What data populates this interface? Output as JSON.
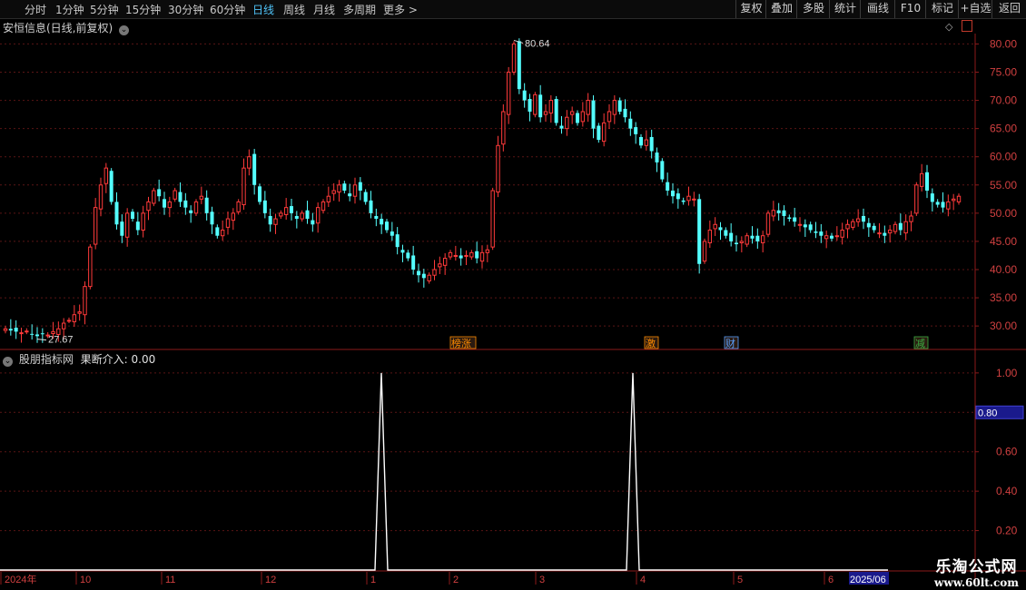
{
  "toolbar": {
    "periods": [
      "分时",
      "1分钟",
      "5分钟",
      "15分钟",
      "30分钟",
      "60分钟",
      "日线",
      "周线",
      "月线",
      "多周期",
      "更多 >"
    ],
    "active_period": "日线",
    "buttons": [
      "复权",
      "叠加",
      "多股",
      "统计",
      "画线",
      "F10",
      "标记",
      "+自选",
      "返回"
    ]
  },
  "main_panel": {
    "title": "安恒信息(日线,前复权)",
    "y_ticks": [
      "80.00",
      "75.00",
      "70.00",
      "65.00",
      "60.00",
      "55.00",
      "50.00",
      "45.00",
      "40.00",
      "35.00",
      "30.00"
    ],
    "high_label": "80.64",
    "low_label": "27.67",
    "event_tags": [
      {
        "label": "榜涨",
        "color": "#ff8c00"
      },
      {
        "label": "激",
        "color": "#ff8c00"
      },
      {
        "label": "财",
        "color": "#5aa0ff"
      },
      {
        "label": "减",
        "color": "#3cb043"
      }
    ]
  },
  "indicator_panel": {
    "title": "股朋指标网",
    "value_label": "果断介入: 0.00",
    "y_ticks": [
      "1.00",
      "0.80",
      "0.60",
      "0.40",
      "0.20"
    ],
    "cursor_value": "0.80"
  },
  "date_axis": {
    "labels": [
      "2024年",
      "10",
      "11",
      "12",
      "1",
      "2",
      "3",
      "4",
      "5",
      "6",
      "2025/06"
    ]
  },
  "watermark": {
    "line1": "乐淘公式网",
    "line2": "www.60lt.com"
  },
  "chart_data": {
    "type": "candlestick",
    "y_range": [
      26,
      82
    ],
    "indicator_y_range": [
      0,
      1.05
    ],
    "high": 80.64,
    "low": 27.67,
    "indicator_spikes": [
      {
        "month_label": "1",
        "value": 1.0
      },
      {
        "month_label": "4",
        "value": 1.0
      }
    ],
    "closes_approx": [
      29.5,
      29.2,
      29,
      28.8,
      29.1,
      28.5,
      28.2,
      28.6,
      28.4,
      29,
      29.5,
      30.5,
      31,
      32,
      32.5,
      37,
      44,
      51,
      55,
      58,
      52,
      48,
      46,
      50,
      49,
      47,
      50,
      52,
      54,
      53,
      51,
      52,
      54,
      52,
      51,
      50,
      52,
      53,
      50,
      48,
      46,
      47,
      49,
      50,
      52,
      58,
      60,
      55,
      52,
      50,
      48,
      49,
      50,
      51,
      50,
      49,
      50,
      49,
      48,
      51,
      52,
      53,
      54,
      55,
      54,
      53,
      55,
      54,
      52,
      50,
      49,
      48,
      47,
      46,
      44,
      43,
      42,
      40,
      39,
      38.5,
      39,
      40,
      41,
      42,
      43,
      42.5,
      42,
      42.5,
      43,
      42,
      43,
      43.5,
      54,
      62,
      68,
      75,
      80,
      72,
      70,
      68,
      71,
      67,
      68,
      70,
      66,
      65,
      67,
      68,
      66,
      68,
      70,
      65,
      63,
      66,
      68,
      70,
      68,
      67,
      65,
      64,
      62,
      63,
      61,
      59,
      56,
      54,
      53,
      52.5,
      52,
      53,
      52.5,
      41,
      45,
      47,
      48,
      47,
      46,
      45,
      44.5,
      45,
      46,
      45.5,
      45,
      46,
      50,
      50.5,
      50,
      49.5,
      49,
      48.5,
      48,
      47.5,
      47,
      46.5,
      46,
      46,
      45.5,
      46,
      47,
      48,
      48.5,
      49,
      48.5,
      47.5,
      47,
      46.5,
      46,
      47,
      48,
      47,
      48.5,
      49.5,
      55,
      57,
      54,
      52,
      51.5,
      51,
      52,
      52.5,
      53
    ]
  }
}
